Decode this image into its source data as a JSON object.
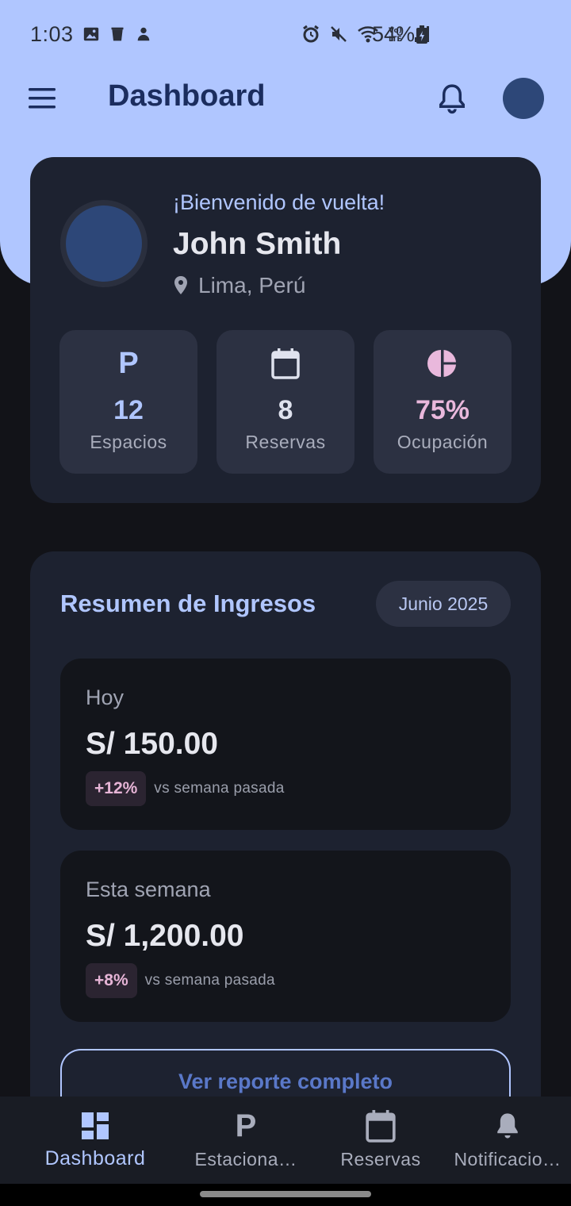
{
  "status_bar": {
    "time": "1:03",
    "battery": "54%"
  },
  "app_bar": {
    "title": "Dashboard"
  },
  "welcome": {
    "greeting": "¡Bienvenido de vuelta!",
    "name": "John Smith",
    "location": "Lima, Perú",
    "stats": [
      {
        "icon": "parking-icon",
        "value": "12",
        "label": "Espacios",
        "color": "#b0c6ff"
      },
      {
        "icon": "calendar-icon",
        "value": "8",
        "label": "Reservas",
        "color": "#dfe2ee"
      },
      {
        "icon": "pie-chart-icon",
        "value": "75%",
        "label": "Ocupación",
        "color": "#e9b8dc"
      }
    ]
  },
  "income": {
    "title": "Resumen de Ingresos",
    "period": "Junio 2025",
    "cards": [
      {
        "label": "Hoy",
        "amount": "S/ 150.00",
        "change": "+12%",
        "compare": "vs semana pasada"
      },
      {
        "label": "Esta semana",
        "amount": "S/ 1,200.00",
        "change": "+8%",
        "compare": "vs semana pasada"
      }
    ],
    "report_button": "Ver reporte completo"
  },
  "bottom_nav": {
    "items": [
      {
        "label": "Dashboard",
        "icon": "dashboard-icon",
        "active": true
      },
      {
        "label": "Estaciona…",
        "icon": "parking-icon",
        "active": false
      },
      {
        "label": "Reservas",
        "icon": "calendar-icon",
        "active": false
      },
      {
        "label": "Notificacio…",
        "icon": "bell-icon",
        "active": false
      }
    ]
  },
  "colors": {
    "header": "#b0c6ff",
    "background": "#121318",
    "card": "#1d2230",
    "accent": "#b0c6ff",
    "badge_text": "#e6b4d6"
  }
}
